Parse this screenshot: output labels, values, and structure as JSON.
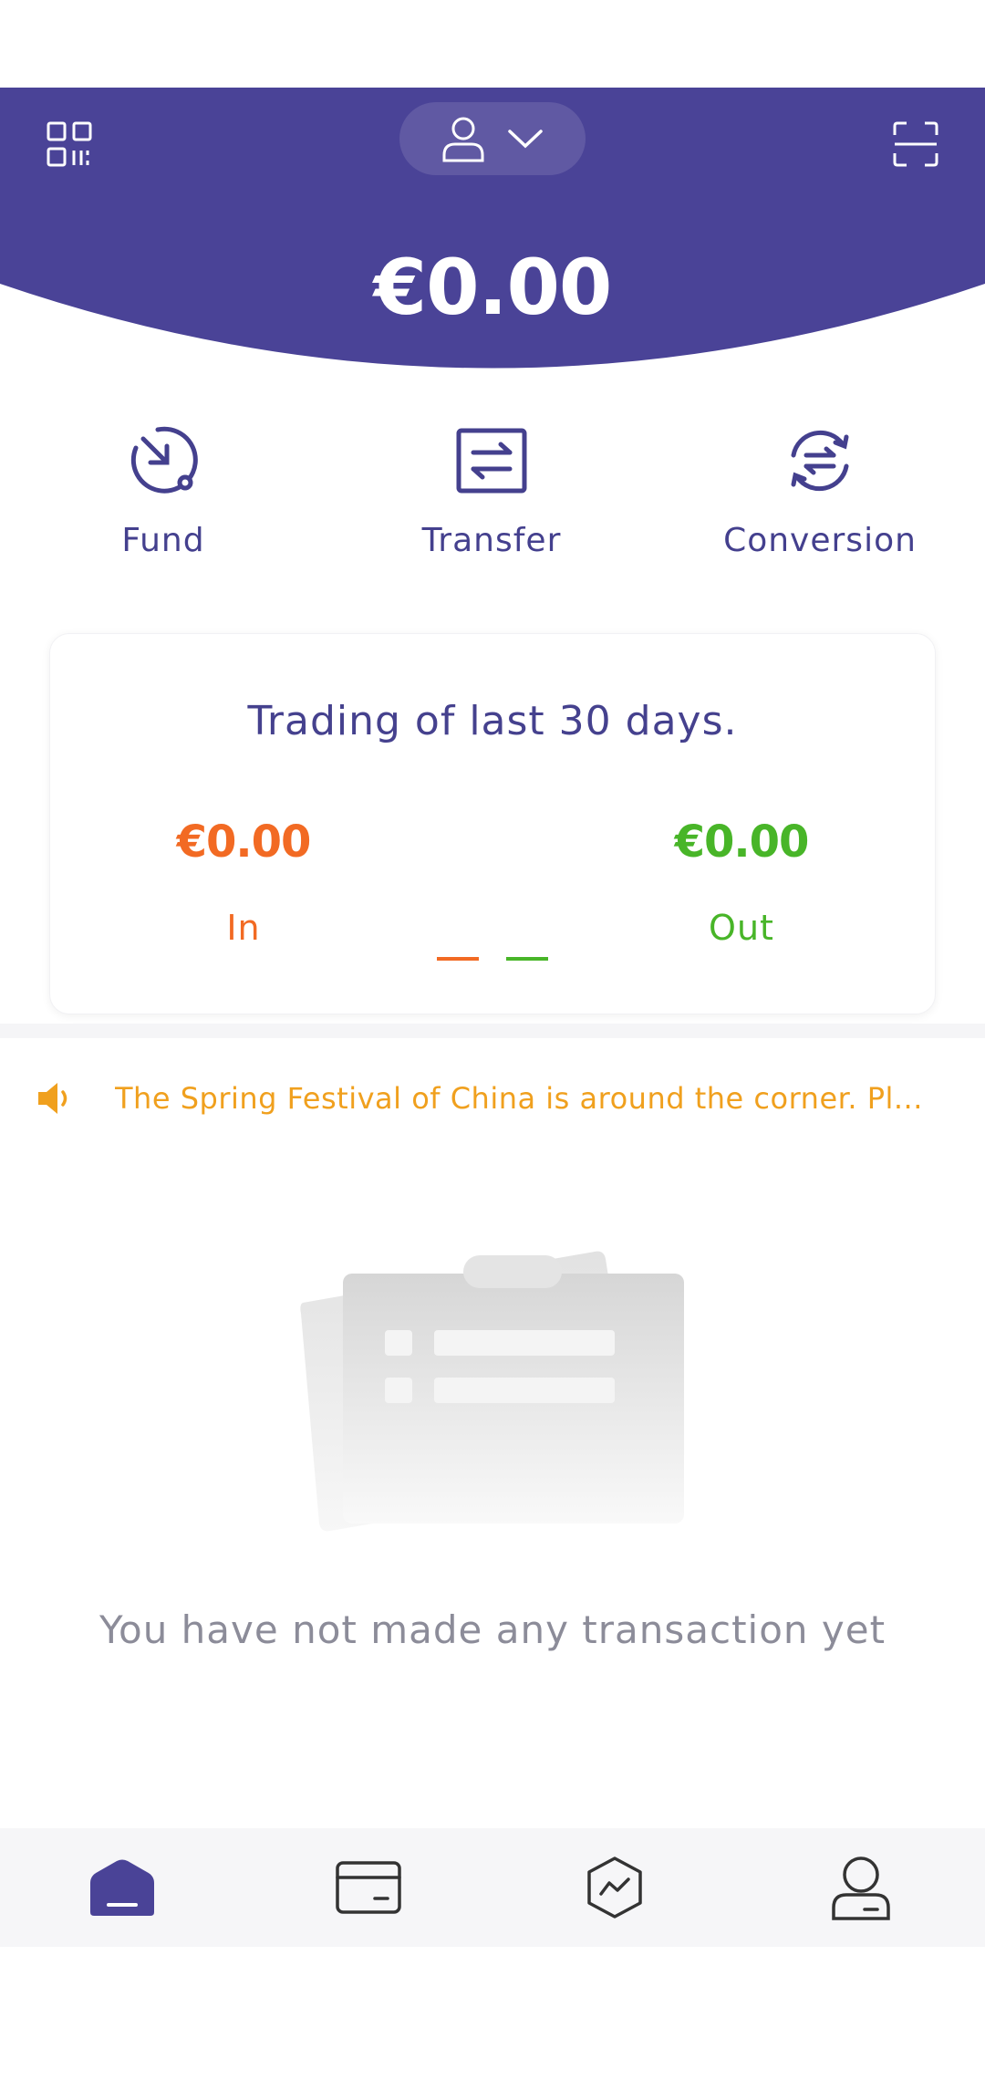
{
  "colors": {
    "brand": "#4a4397",
    "text_primary": "#45418e",
    "in": "#f26a23",
    "out": "#48b528",
    "notice": "#f0a01e",
    "muted": "#8c8c99"
  },
  "header": {
    "balance": "€0.00",
    "icons": {
      "left": "qr-code-icon",
      "account": "user-icon",
      "dropdown": "chevron-down-icon",
      "right": "scan-icon"
    }
  },
  "actions": [
    {
      "label": "Fund",
      "icon": "fund-icon"
    },
    {
      "label": "Transfer",
      "icon": "transfer-icon"
    },
    {
      "label": "Conversion",
      "icon": "conversion-icon"
    }
  ],
  "trading": {
    "title": "Trading of last 30 days.",
    "in_amount": "€0.00",
    "in_label": "In",
    "out_amount": "€0.00",
    "out_label": "Out"
  },
  "notice": {
    "icon": "speaker-icon",
    "text": "The Spring Festival of China is around the corner. Pl..."
  },
  "empty_state": {
    "message": "You have not made any transaction yet"
  },
  "bottom_nav": {
    "items": [
      {
        "name": "home",
        "icon": "home-icon",
        "active": true
      },
      {
        "name": "card",
        "icon": "card-icon",
        "active": false
      },
      {
        "name": "market",
        "icon": "market-icon",
        "active": false
      },
      {
        "name": "profile",
        "icon": "profile-icon",
        "active": false
      }
    ]
  }
}
